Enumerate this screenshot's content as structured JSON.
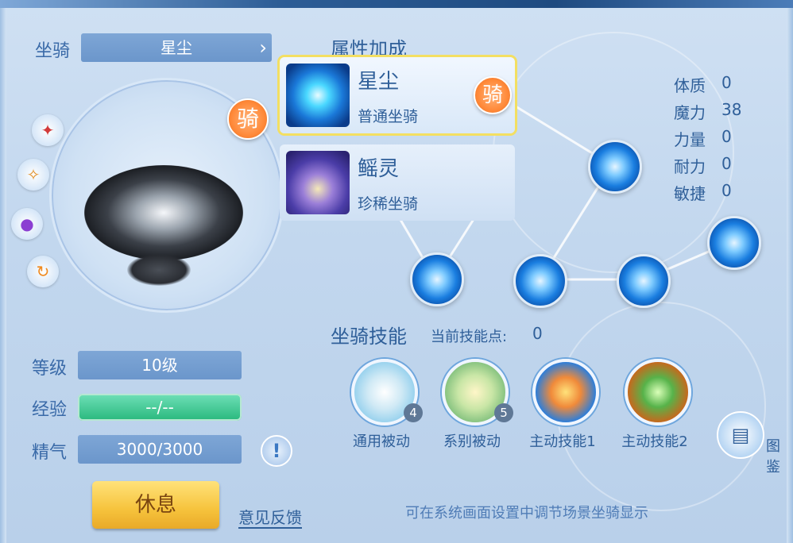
{
  "left_panel": {
    "mount_label": "坐骑",
    "mount_selected": "星尘",
    "ride_badge": "骑",
    "level_label": "等级",
    "level_value": "10级",
    "exp_label": "经验",
    "exp_value": "--/--",
    "spirit_label": "精气",
    "spirit_value": "3000/3000",
    "info_icon": "!",
    "rest_button": "休息",
    "feedback_link": "意见反馈"
  },
  "right_panel": {
    "attr_title": "属性加成",
    "mounts": [
      {
        "name": "星尘",
        "type": "普通坐骑",
        "badge": "骑"
      },
      {
        "name": "鳐灵",
        "type": "珍稀坐骑"
      }
    ],
    "attributes": [
      {
        "name": "体质",
        "value": "0"
      },
      {
        "name": "魔力",
        "value": "38"
      },
      {
        "name": "力量",
        "value": "0"
      },
      {
        "name": "耐力",
        "value": "0"
      },
      {
        "name": "敏捷",
        "value": "0"
      }
    ],
    "skills_title": "坐骑技能",
    "skill_points_label": "当前技能点:",
    "skill_points_value": "0",
    "skills": [
      {
        "label": "通用被动",
        "count": "4"
      },
      {
        "label": "系别被动",
        "count": "5"
      },
      {
        "label": "主动技能1"
      },
      {
        "label": "主动技能2"
      }
    ],
    "atlas_label": "图鉴",
    "tip": "可在系统画面设置中调节场景坐骑显示"
  },
  "icons": {
    "side_icons": [
      "attack-rune-icon",
      "scroll-icon",
      "color-orb-icon",
      "refresh-icon"
    ],
    "atlas_icon": "book-icon",
    "next_arrow": "chevron-right-icon"
  },
  "colors": {
    "accent": "#2f5f99",
    "exp_green": "#29b87d",
    "rest_yellow": "#f6c33c",
    "ride_orange": "#ff8a3a",
    "selected_border": "#f3df62"
  }
}
